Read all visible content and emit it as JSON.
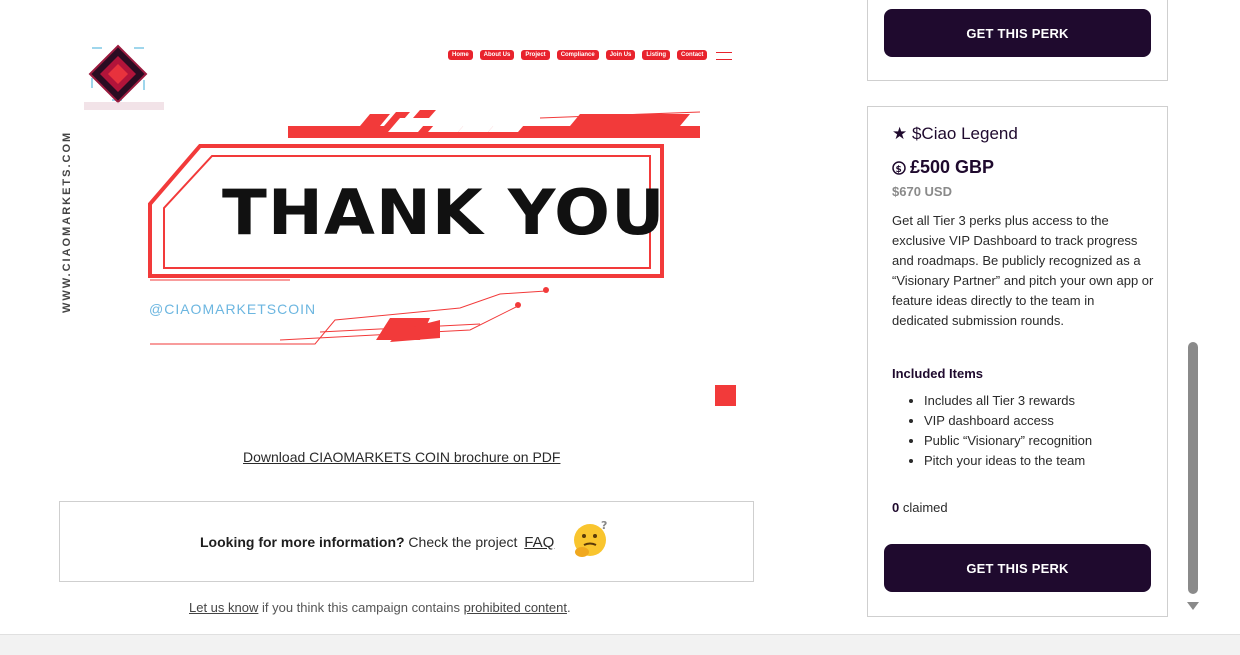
{
  "banner": {
    "nav": [
      "Home",
      "About Us",
      "Project",
      "Compliance",
      "Join Us",
      "Listing",
      "Contact"
    ],
    "vertical_text": "WWW.CIAOMARKETS.COM",
    "headline": "THANK YOU",
    "handle": "@CIAOMARKETSCOIN"
  },
  "download_link": "Download CIAOMARKETS COIN brochure on PDF",
  "info": {
    "bold": "Looking for more information?",
    "text": " Check the project ",
    "faq": "FAQ"
  },
  "report": {
    "link1": "Let us know",
    "middle": " if you think this campaign contains ",
    "link2": "prohibited content",
    "end": "."
  },
  "top_card": {
    "button": "GET THIS PERK"
  },
  "perk": {
    "title": "★ $Ciao Legend",
    "price": "£500 GBP",
    "usd": "$670 USD",
    "description": "Get all Tier 3 perks plus access to the exclusive VIP Dashboard to track progress and roadmaps. Be publicly recognized as a “Visionary Partner” and pitch your own app or feature ideas directly to the team in dedicated submission rounds.",
    "included_heading": "Included Items",
    "items": [
      "Includes all Tier 3 rewards",
      "VIP dashboard access",
      "Public “Visionary” recognition",
      "Pitch your ideas to the team"
    ],
    "claimed_count": "0",
    "claimed_label": " claimed",
    "button": "GET THIS PERK"
  },
  "colors": {
    "brand_red": "#e8232d",
    "button_dark": "#1f0a2e"
  }
}
